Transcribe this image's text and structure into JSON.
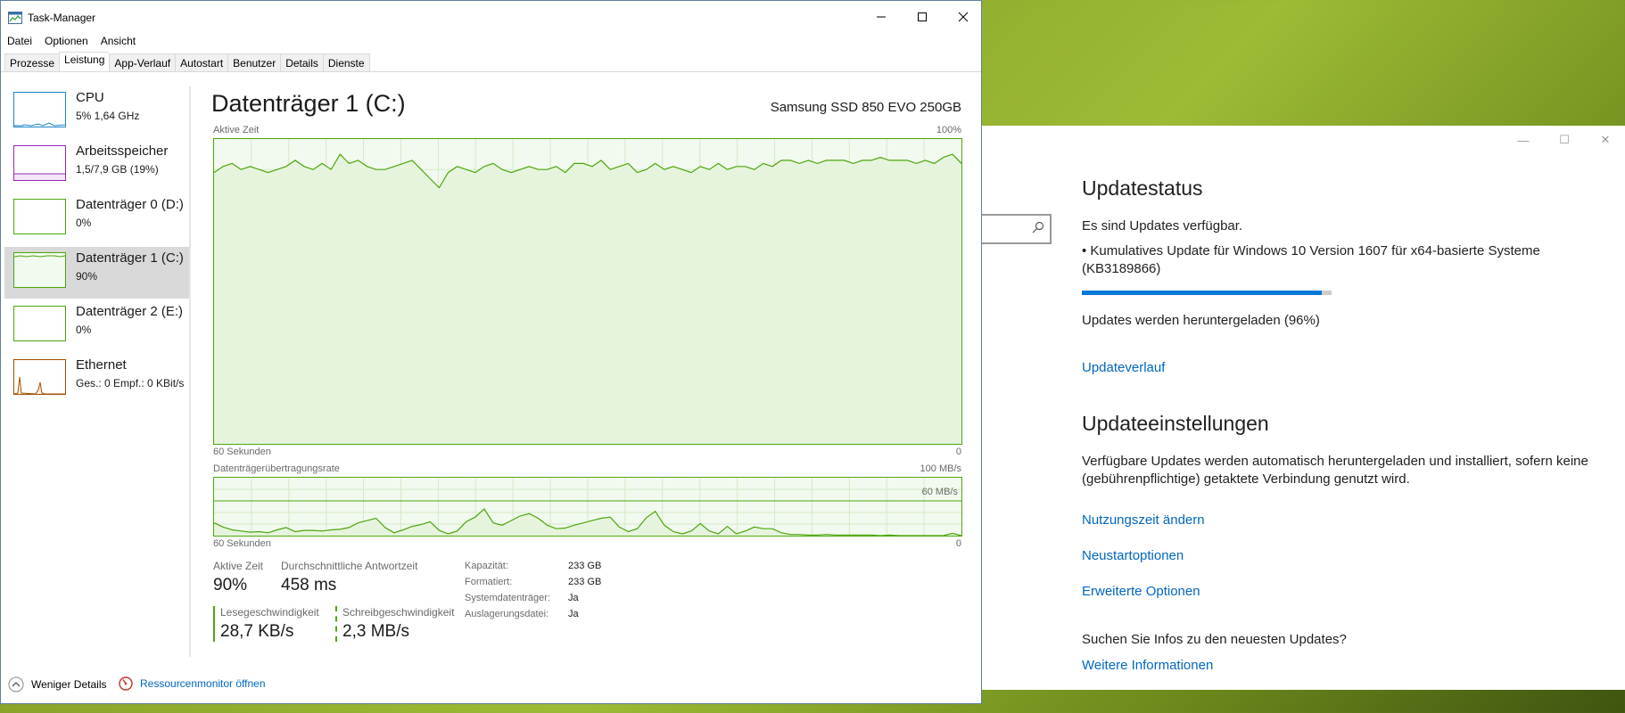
{
  "settings": {
    "update_status_title": "Updatestatus",
    "updates_available": "Es sind Updates verfügbar.",
    "update_item": "• Kumulatives Update für Windows 10 Version 1607 für x64-basierte Systeme (KB3189866)",
    "download_progress": 0.96,
    "download_status": "Updates werden heruntergeladen (96%)",
    "update_history_link": "Updateverlauf",
    "update_settings_title": "Updateeinstellungen",
    "auto_text": "Verfügbare Updates werden automatisch heruntergeladen und installiert, sofern keine (gebührenpflichtige) getaktete Verbindung genutzt wird.",
    "active_hours_link": "Nutzungszeit ändern",
    "restart_options_link": "Neustartoptionen",
    "advanced_options_link": "Erweiterte Optionen",
    "info_question": "Suchen Sie Infos zu den neuesten Updates?",
    "more_info_link": "Weitere Informationen"
  },
  "taskmgr": {
    "title": "Task-Manager",
    "menu": [
      "Datei",
      "Optionen",
      "Ansicht"
    ],
    "tabs": [
      "Prozesse",
      "Leistung",
      "App-Verlauf",
      "Autostart",
      "Benutzer",
      "Details",
      "Dienste"
    ],
    "active_tab": "Leistung",
    "sidebar": [
      {
        "name": "CPU",
        "sub": "5% 1,64 GHz",
        "color": "#1a86c7"
      },
      {
        "name": "Arbeitsspeicher",
        "sub": "1,5/7,9 GB (19%)",
        "color": "#9528b4"
      },
      {
        "name": "Datenträger 0 (D:)",
        "sub": "0%",
        "color": "#4da60c"
      },
      {
        "name": "Datenträger 1 (C:)",
        "sub": "90%",
        "color": "#4da60c"
      },
      {
        "name": "Datenträger 2 (E:)",
        "sub": "0%",
        "color": "#4da60c"
      },
      {
        "name": "Ethernet",
        "sub": "Ges.: 0 Empf.: 0 KBit/s",
        "color": "#a74f01"
      }
    ],
    "disk": {
      "title": "Datenträger 1 (C:)",
      "model": "Samsung SSD 850 EVO 250GB",
      "graph1_label": "Aktive Zeit",
      "graph1_max": "100%",
      "graph1_time": "60 Sekunden",
      "graph1_min": "0",
      "graph2_label": "Datenträgerübertragungsrate",
      "graph2_max": "100 MB/s",
      "graph2_mid": "60 MB/s",
      "graph2_time": "60 Sekunden",
      "graph2_min": "0",
      "active_time_label": "Aktive Zeit",
      "active_time_value": "90%",
      "response_label": "Durchschnittliche Antwortzeit",
      "response_value": "458 ms",
      "read_label": "Lesegeschwindigkeit",
      "read_value": "28,7 KB/s",
      "write_label": "Schreibgeschwindigkeit",
      "write_value": "2,3 MB/s",
      "props": [
        {
          "k": "Kapazität:",
          "v": "233 GB"
        },
        {
          "k": "Formatiert:",
          "v": "233 GB"
        },
        {
          "k": "Systemdatenträger:",
          "v": "Ja"
        },
        {
          "k": "Auslagerungsdatei:",
          "v": "Ja"
        }
      ]
    },
    "fewer_details": "Weniger Details",
    "resource_monitor": "Ressourcenmonitor öffnen"
  },
  "chart_data": [
    {
      "type": "line",
      "title": "Aktive Zeit",
      "xlabel": "60 Sekunden",
      "ylim": [
        0,
        100
      ],
      "series": [
        {
          "values": [
            89,
            91,
            92,
            90,
            91,
            90,
            89,
            90,
            91,
            93,
            91,
            90,
            92,
            90,
            95,
            92,
            93,
            91,
            90,
            90,
            91,
            92,
            93,
            90,
            87,
            84,
            89,
            91,
            90,
            89,
            91,
            92,
            90,
            89,
            90,
            91,
            90,
            90,
            91,
            89,
            92,
            92,
            91,
            93,
            90,
            91,
            92,
            89,
            90,
            92,
            90,
            91,
            90,
            89,
            91,
            90,
            92,
            90,
            91,
            91,
            90,
            92,
            91,
            93,
            93,
            92,
            93,
            92,
            93,
            93,
            93,
            92,
            93,
            93,
            94,
            93,
            93,
            93,
            92,
            93,
            92,
            94,
            95,
            92
          ]
        }
      ]
    },
    {
      "type": "line",
      "title": "Datenträgerübertragungsrate",
      "xlabel": "60 Sekunden",
      "ylim": [
        0,
        100
      ],
      "series": [
        {
          "values": [
            22,
            15,
            10,
            8,
            6,
            7,
            5,
            10,
            14,
            7,
            9,
            9,
            8,
            10,
            11,
            14,
            22,
            26,
            30,
            14,
            5,
            10,
            16,
            19,
            24,
            9,
            3,
            8,
            24,
            32,
            46,
            22,
            18,
            26,
            34,
            38,
            30,
            18,
            12,
            13,
            18,
            22,
            26,
            30,
            32,
            15,
            7,
            12,
            31,
            42,
            18,
            7,
            3,
            8,
            21,
            8,
            3,
            16,
            3,
            8,
            15,
            12,
            12,
            5,
            2,
            2,
            1,
            1,
            2,
            1,
            1,
            1,
            1,
            1,
            0,
            1,
            0,
            0,
            0,
            0,
            0,
            0,
            4,
            0
          ]
        }
      ]
    }
  ]
}
